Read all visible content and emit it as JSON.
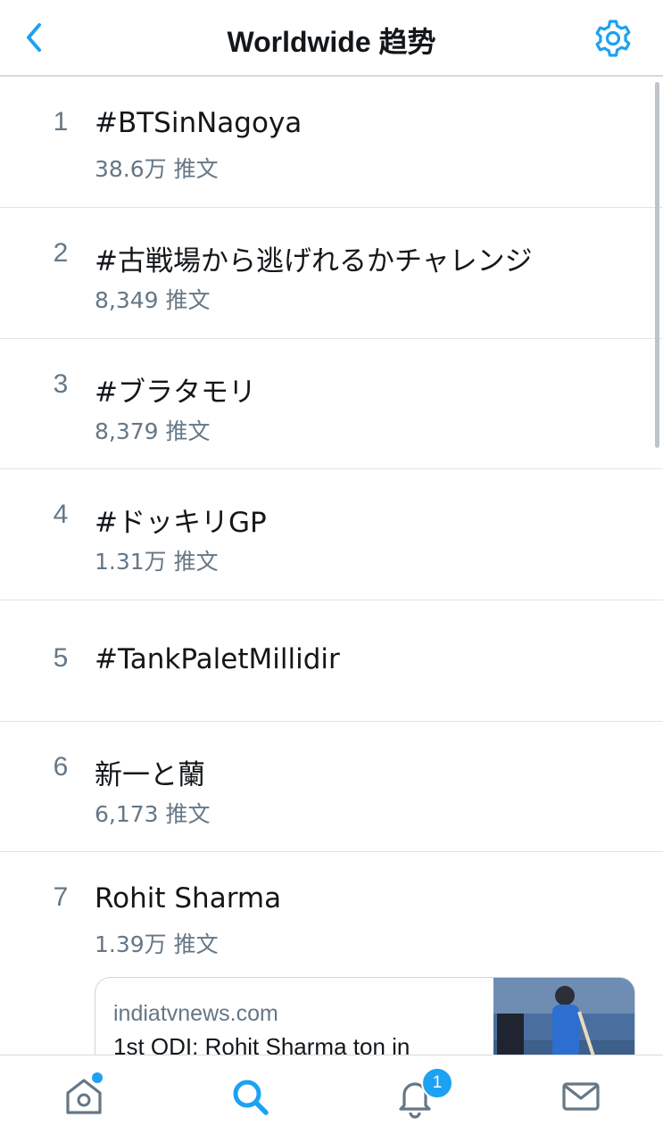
{
  "header": {
    "title": "Worldwide 趋势",
    "back_icon": "chevron-left-icon",
    "settings_icon": "gear-icon"
  },
  "colors": {
    "accent": "#1da1f2",
    "text": "#14171a",
    "secondary": "#657786",
    "divider": "#e1e4e7"
  },
  "trends": [
    {
      "rank": "1",
      "name": "#BTSinNagoya",
      "count": "38.6万 推文"
    },
    {
      "rank": "2",
      "name": "#古戦場から逃げれるかチャレンジ",
      "count": "8,349 推文"
    },
    {
      "rank": "3",
      "name": "#ブラタモリ",
      "count": "8,379 推文"
    },
    {
      "rank": "4",
      "name": "#ドッキリGP",
      "count": "1.31万 推文"
    },
    {
      "rank": "5",
      "name": "#TankPaletMillidir",
      "count": ""
    },
    {
      "rank": "6",
      "name": "新一と蘭",
      "count": "6,173 推文"
    },
    {
      "rank": "7",
      "name": "Rohit Sharma",
      "count": "1.39万 推文"
    }
  ],
  "news_card": {
    "domain": "indiatvnews.com",
    "headline": "1st ODI: Rohit Sharma ton in"
  },
  "tabbar": {
    "items": [
      {
        "name": "home",
        "icon": "home-icon"
      },
      {
        "name": "search",
        "icon": "search-icon",
        "active": true
      },
      {
        "name": "notifications",
        "icon": "bell-icon"
      },
      {
        "name": "messages",
        "icon": "mail-icon"
      }
    ],
    "notification_badge": "1"
  }
}
